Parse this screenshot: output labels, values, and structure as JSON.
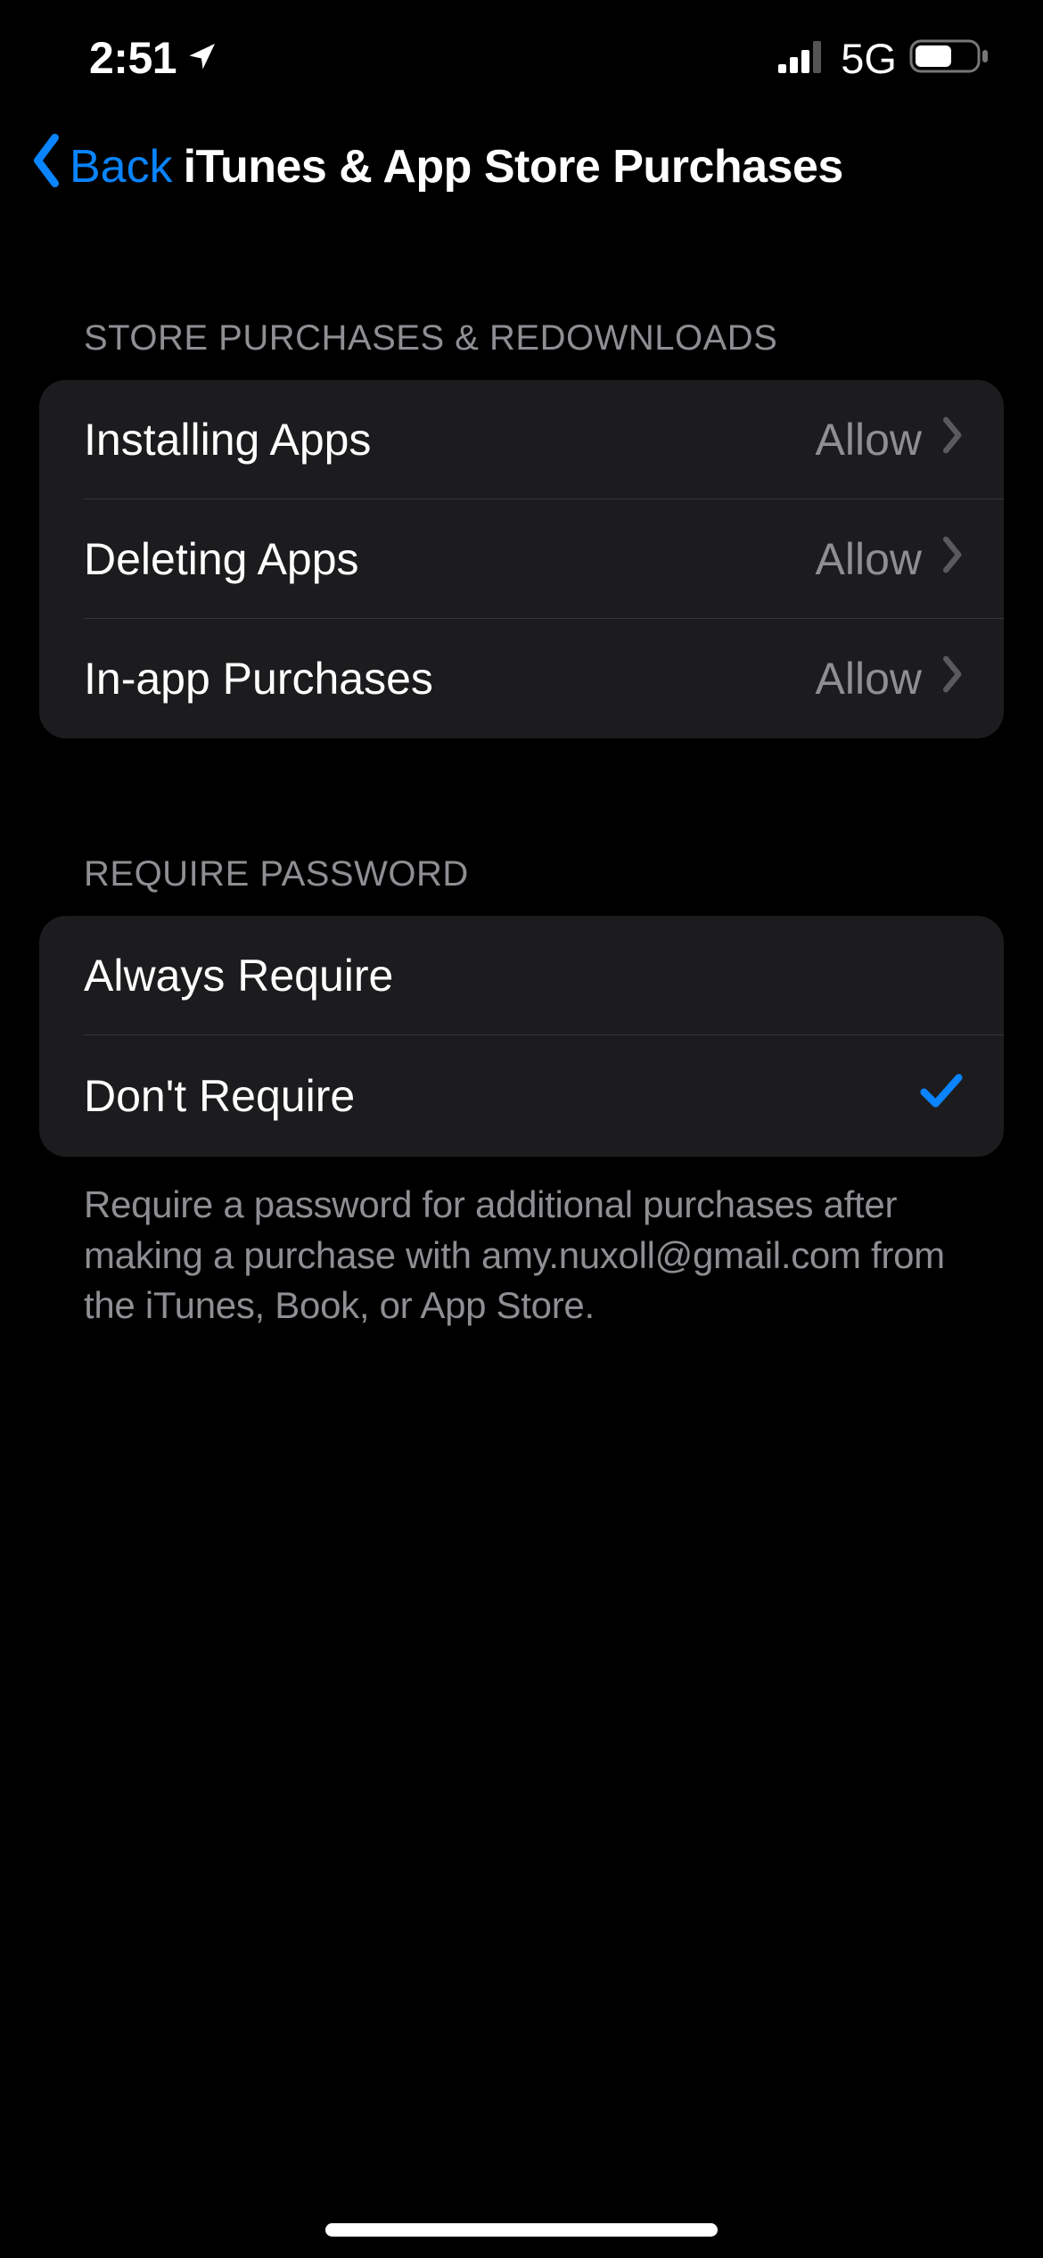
{
  "status": {
    "time": "2:51",
    "network_label": "5G"
  },
  "nav": {
    "back_label": "Back",
    "title": "iTunes & App Store Purchases"
  },
  "section_store": {
    "header": "Store Purchases & Redownloads",
    "items": [
      {
        "label": "Installing Apps",
        "value": "Allow"
      },
      {
        "label": "Deleting Apps",
        "value": "Allow"
      },
      {
        "label": "In-app Purchases",
        "value": "Allow"
      }
    ]
  },
  "section_password": {
    "header": "Require Password",
    "items": [
      {
        "label": "Always Require",
        "checked": false
      },
      {
        "label": "Don't Require",
        "checked": true
      }
    ],
    "footer": "Require a password for additional purchases after making a purchase with amy.nuxoll@gmail.com from the iTunes, Book, or App Store."
  }
}
